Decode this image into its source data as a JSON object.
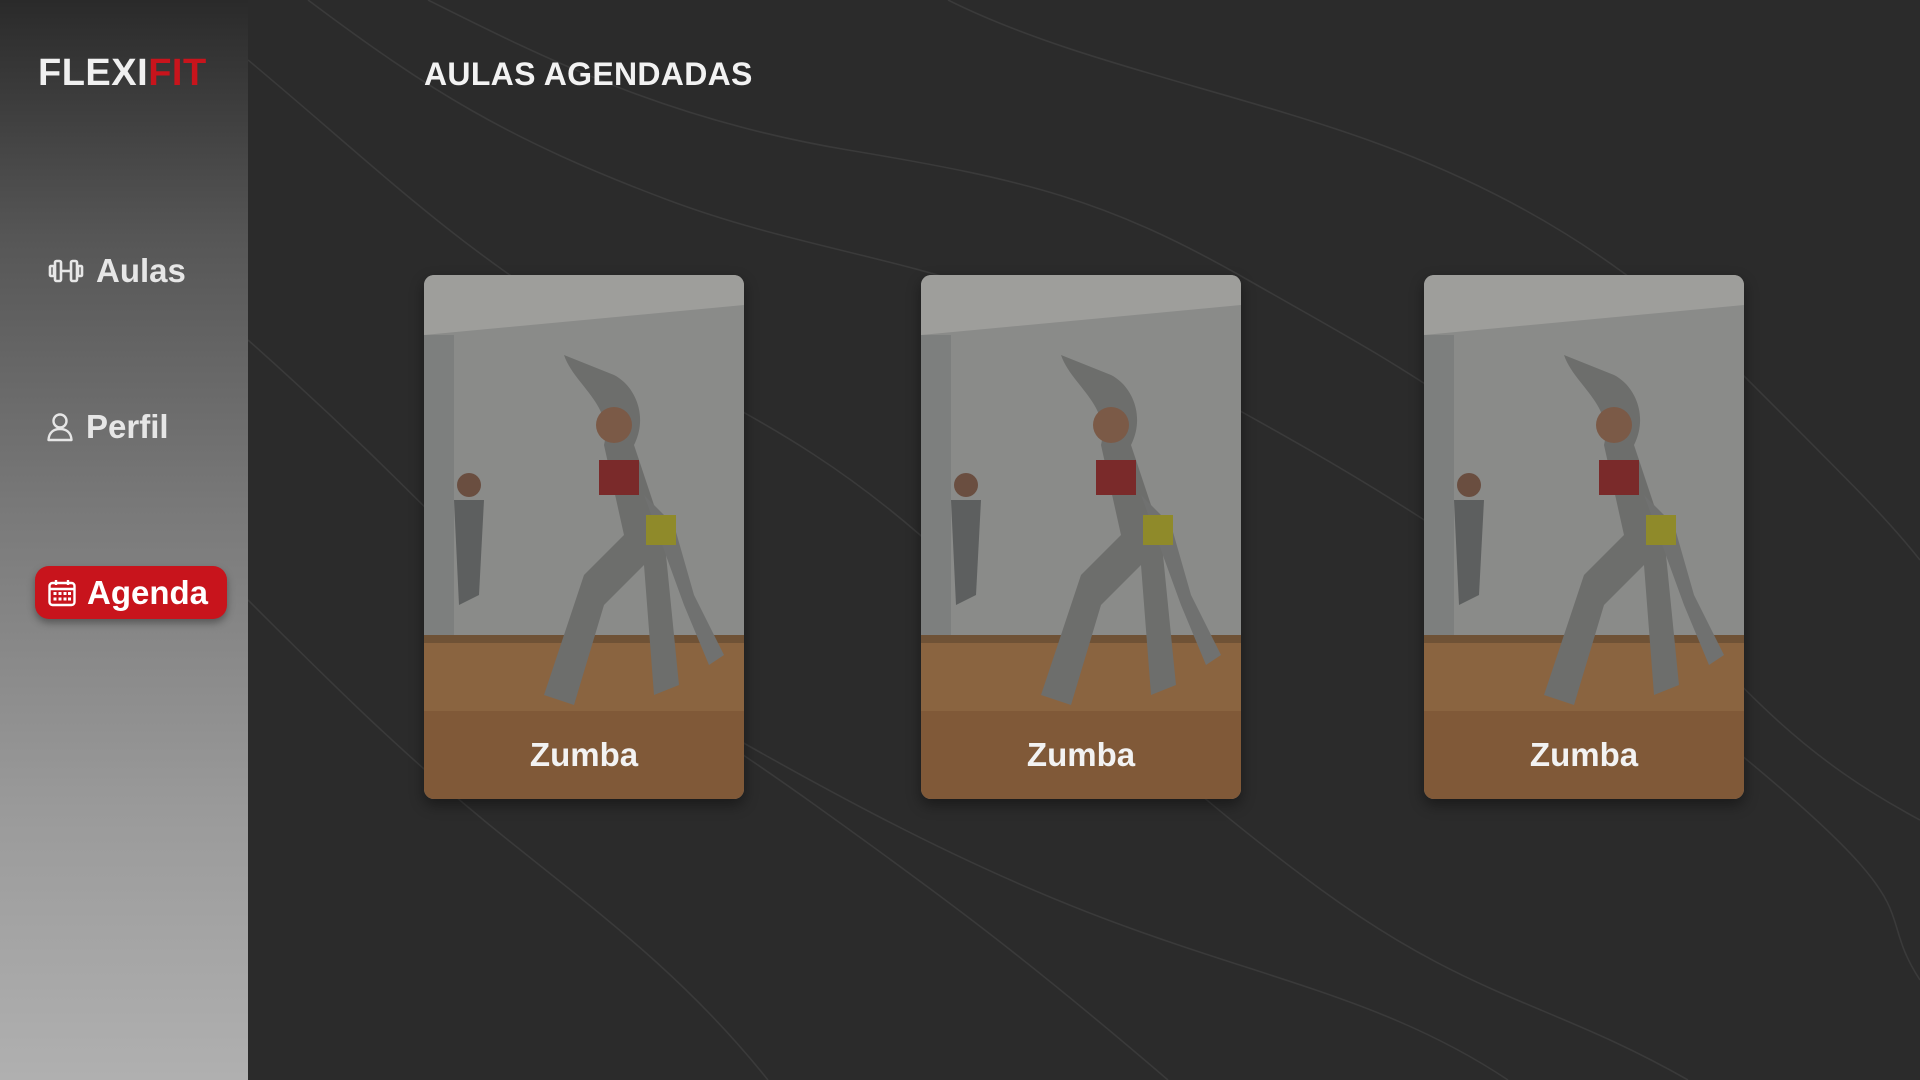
{
  "brand": {
    "logo_primary": "FLEXI",
    "logo_accent": "FIT",
    "accent_color": "#c8141c"
  },
  "sidebar": {
    "items": [
      {
        "label": "Aulas",
        "icon": "dumbbell-icon",
        "active": false
      },
      {
        "label": "Perfil",
        "icon": "user-icon",
        "active": false
      },
      {
        "label": "Agenda",
        "icon": "calendar-icon",
        "active": true
      }
    ]
  },
  "main": {
    "title": "AULAS AGENDADAS",
    "classes": [
      {
        "name": "Zumba"
      },
      {
        "name": "Zumba"
      },
      {
        "name": "Zumba"
      }
    ]
  }
}
